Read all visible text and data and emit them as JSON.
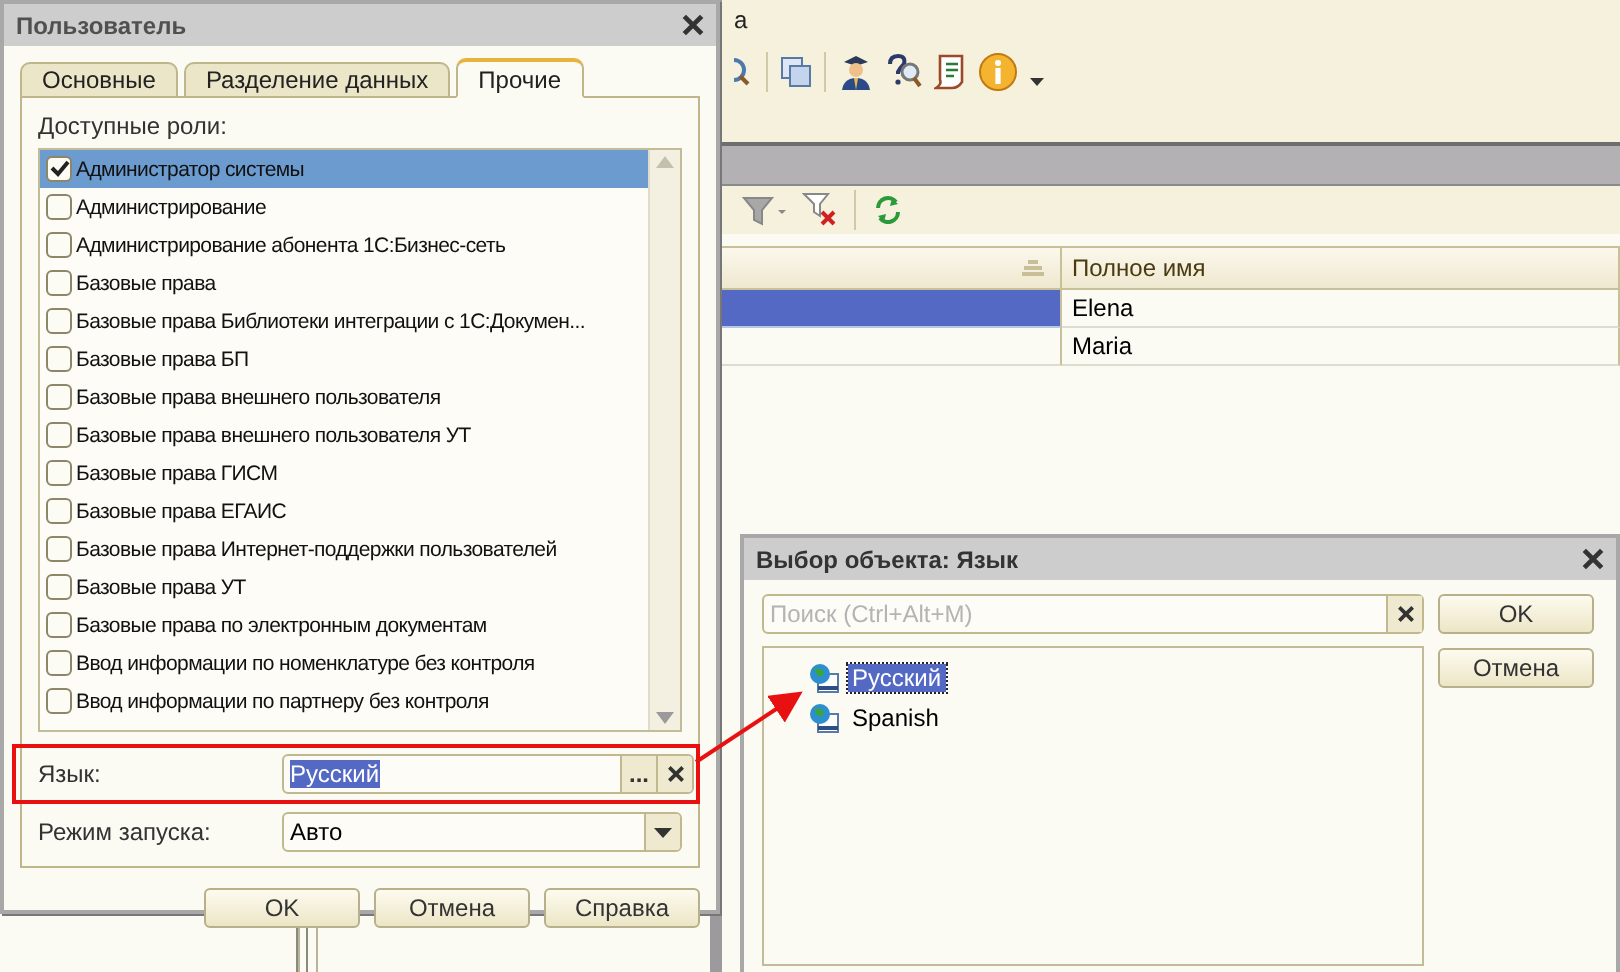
{
  "background": {
    "title_fragment": "а",
    "table": {
      "columns": [
        "Полное имя"
      ],
      "rows": [
        {
          "full_name": "Elena",
          "selected": true
        },
        {
          "full_name": "Maria",
          "selected": false
        }
      ]
    }
  },
  "user_dialog": {
    "title": "Пользователь",
    "tabs": [
      {
        "label": "Основные",
        "selected": false
      },
      {
        "label": "Разделение данных",
        "selected": false
      },
      {
        "label": "Прочие",
        "selected": true
      }
    ],
    "roles_label": "Доступные роли:",
    "roles": [
      {
        "label": "Администратор системы",
        "checked": true,
        "selected": true
      },
      {
        "label": "Администрирование",
        "checked": false,
        "selected": false
      },
      {
        "label": "Администрирование абонента 1С:Бизнес-сеть",
        "checked": false,
        "selected": false
      },
      {
        "label": "Базовые права",
        "checked": false,
        "selected": false
      },
      {
        "label": "Базовые права Библиотеки интеграции с 1С:Докумен...",
        "checked": false,
        "selected": false
      },
      {
        "label": "Базовые права БП",
        "checked": false,
        "selected": false
      },
      {
        "label": "Базовые права внешнего пользователя",
        "checked": false,
        "selected": false
      },
      {
        "label": "Базовые права внешнего пользователя УТ",
        "checked": false,
        "selected": false
      },
      {
        "label": "Базовые права ГИСМ",
        "checked": false,
        "selected": false
      },
      {
        "label": "Базовые права ЕГАИС",
        "checked": false,
        "selected": false
      },
      {
        "label": "Базовые права Интернет-поддержки пользователей",
        "checked": false,
        "selected": false
      },
      {
        "label": "Базовые права УТ",
        "checked": false,
        "selected": false
      },
      {
        "label": "Базовые права по электронным документам",
        "checked": false,
        "selected": false
      },
      {
        "label": "Ввод информации по номенклатуре без контроля",
        "checked": false,
        "selected": false
      },
      {
        "label": "Ввод информации по партнеру без контроля",
        "checked": false,
        "selected": false
      }
    ],
    "language": {
      "label": "Язык:",
      "value": "Русский",
      "select_button": "..."
    },
    "launch_mode": {
      "label": "Режим запуска:",
      "value": "Авто"
    },
    "buttons": [
      "OK",
      "Отмена",
      "Справка"
    ]
  },
  "picker_dialog": {
    "title": "Выбор объекта: Язык",
    "search": {
      "placeholder": "Поиск (Ctrl+Alt+M)"
    },
    "items": [
      {
        "label": "Русский",
        "selected": true
      },
      {
        "label": "Spanish",
        "selected": false
      }
    ],
    "buttons": [
      "OK",
      "Отмена"
    ]
  }
}
